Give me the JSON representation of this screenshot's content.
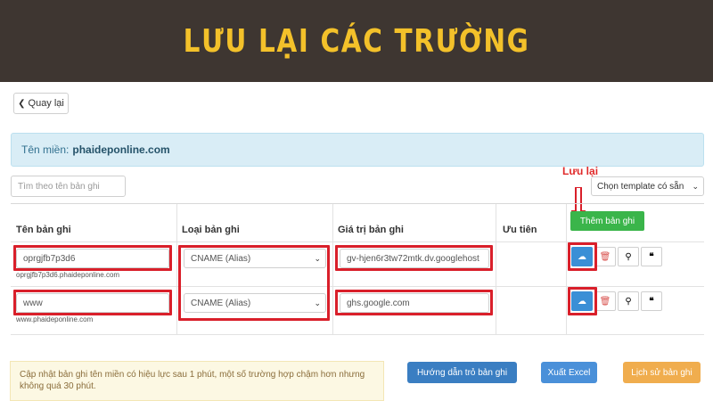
{
  "banner": {
    "title": "LƯU LẠI CÁC TRƯỜNG"
  },
  "toolbar": {
    "back_label": "Quay lại"
  },
  "domain_bar": {
    "label": "Tên miền:",
    "domain": "phaideponline.com"
  },
  "search": {
    "placeholder": "Tìm theo tên bản ghi"
  },
  "annotation": {
    "save_label": "Lưu lại"
  },
  "template_select": {
    "value": "Chọn template có sẵn"
  },
  "add_button": {
    "label": "Thêm bản ghi"
  },
  "table": {
    "headers": [
      "Tên bản ghi",
      "Loại bản ghi",
      "Giá trị bản ghi",
      "Ưu tiên"
    ],
    "rows": [
      {
        "name": "oprgjfb7p3d6",
        "fqdn": "oprgjfb7p3d6.phaideponline.com",
        "type": "CNAME (Alias)",
        "value": "gv-hjen6r3tw72mtk.dv.googlehost"
      },
      {
        "name": "www",
        "fqdn": "www.phaideponline.com",
        "type": "CNAME (Alias)",
        "value": "ghs.google.com"
      }
    ]
  },
  "notice": {
    "text": "Cập nhật bản ghi tên miền có hiệu lực sau 1 phút, một số trường hợp chậm hơn nhưng không quá 30 phút."
  },
  "buttons": {
    "guide": "Hướng dẫn trỏ bản ghi",
    "export": "Xuất Excel",
    "history": "Lịch sử bản ghi"
  },
  "icons": {
    "back": "chevron-left-icon",
    "save": "cloud-upload-icon",
    "delete": "trash-icon",
    "search": "search-icon",
    "quote": "quote-icon",
    "dropdown": "caret-down-icon"
  },
  "colors": {
    "banner_bg": "#3e3631",
    "banner_text": "#f3c12a",
    "highlight": "#d91f2a",
    "save_btn": "#3a8fd6",
    "add_btn": "#3ab54a",
    "guide_btn": "#3a7ec2",
    "export_btn": "#4a90d9",
    "history_btn": "#f0ad4e"
  }
}
